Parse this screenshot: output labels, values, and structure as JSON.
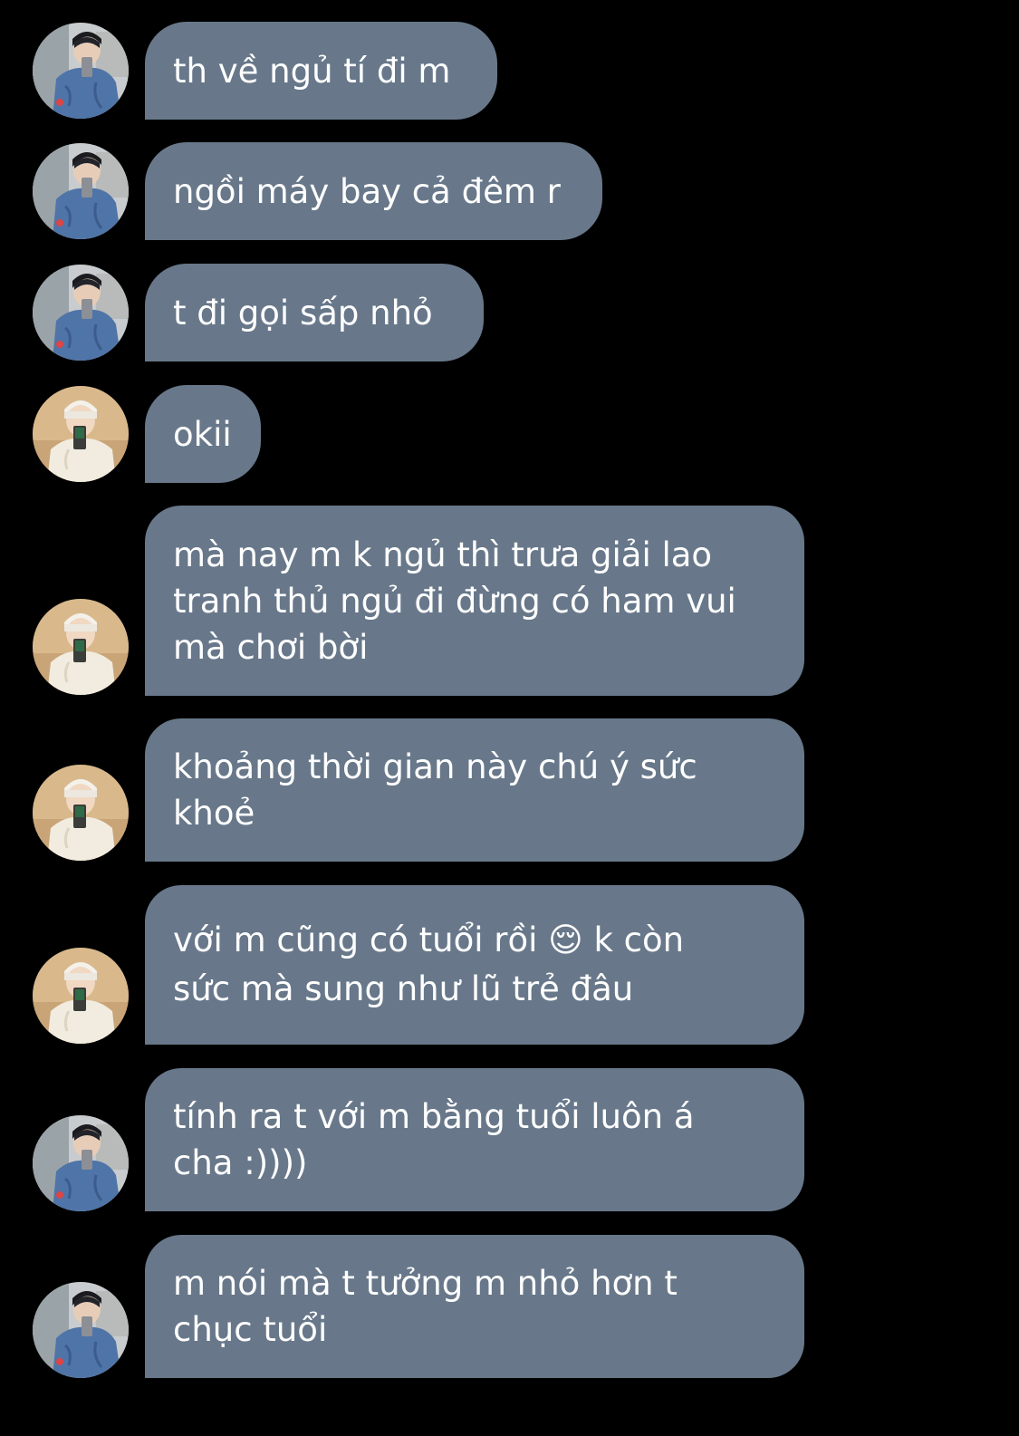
{
  "conversation": {
    "avatar_a_name": "avatar-person-blue-jacket",
    "avatar_b_name": "avatar-person-white-beanie",
    "bubble_color": "#68788a",
    "background_color": "#000000",
    "messages": [
      {
        "sender": "a",
        "text": "th về ngủ tí đi m"
      },
      {
        "sender": "a",
        "text": "ngồi máy bay cả đêm r"
      },
      {
        "sender": "a",
        "text": "t đi gọi sấp nhỏ"
      },
      {
        "sender": "b",
        "text": "okii"
      },
      {
        "sender": "b",
        "text": "mà nay m k ngủ thì trưa giải lao\ntranh thủ ngủ đi đừng có ham vui\nmà chơi bời"
      },
      {
        "sender": "b",
        "text": "khoảng thời gian này chú ý sức\nkhoẻ"
      },
      {
        "sender": "b",
        "text": "với m cũng có tuổi rồi 😌 k còn\nsức mà sung như lũ trẻ đâu"
      },
      {
        "sender": "a",
        "text": "tính ra t với m bằng tuổi luôn á\ncha :))))"
      },
      {
        "sender": "a",
        "text": "m nói mà t tưởng m nhỏ hơn t\nchục tuổi"
      }
    ]
  }
}
